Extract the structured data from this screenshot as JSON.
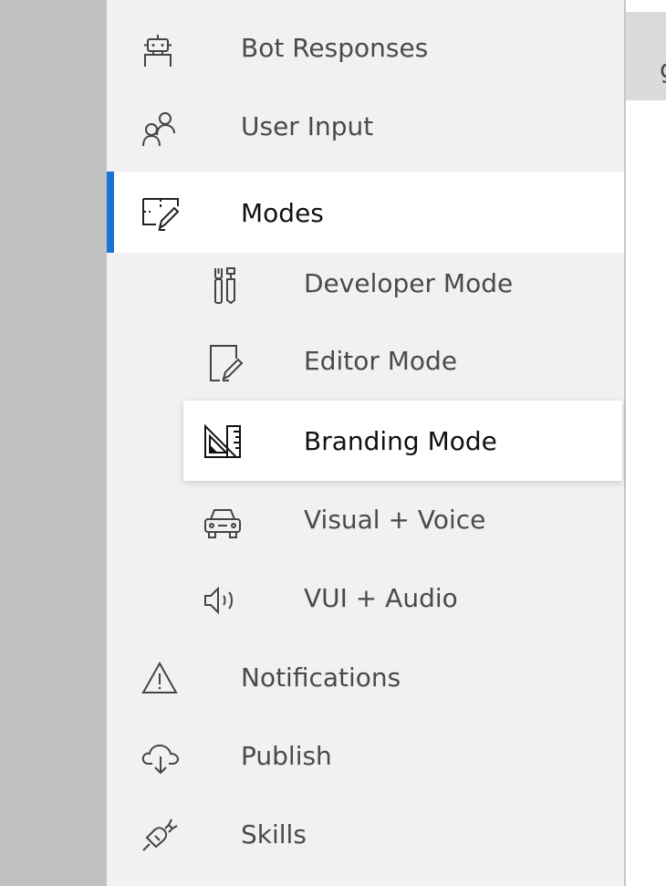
{
  "right_pane": {
    "header_partial_text": "g"
  },
  "nav": {
    "items": [
      {
        "label": "Bot Responses",
        "icon": "bot-icon"
      },
      {
        "label": "User Input",
        "icon": "users-icon"
      },
      {
        "label": "Modes",
        "icon": "design-ideas-icon",
        "state": "selected",
        "children": [
          {
            "label": "Developer Mode",
            "icon": "developer-tools-icon"
          },
          {
            "label": "Editor Mode",
            "icon": "edit-note-icon"
          },
          {
            "label": "Branding Mode",
            "icon": "ruler-design-icon",
            "state": "hovered"
          },
          {
            "label": "Visual + Voice",
            "icon": "car-icon"
          },
          {
            "label": "VUI + Audio",
            "icon": "speaker-volume-icon"
          }
        ]
      },
      {
        "label": "Notifications",
        "icon": "warning-icon"
      },
      {
        "label": "Publish",
        "icon": "cloud-download-icon"
      },
      {
        "label": "Skills",
        "icon": "plug-connection-icon"
      }
    ]
  },
  "colors": {
    "selected_indicator": "#1a73d6",
    "panel_background": "#f2f1f0",
    "left_gutter": "#c1c1c1"
  }
}
